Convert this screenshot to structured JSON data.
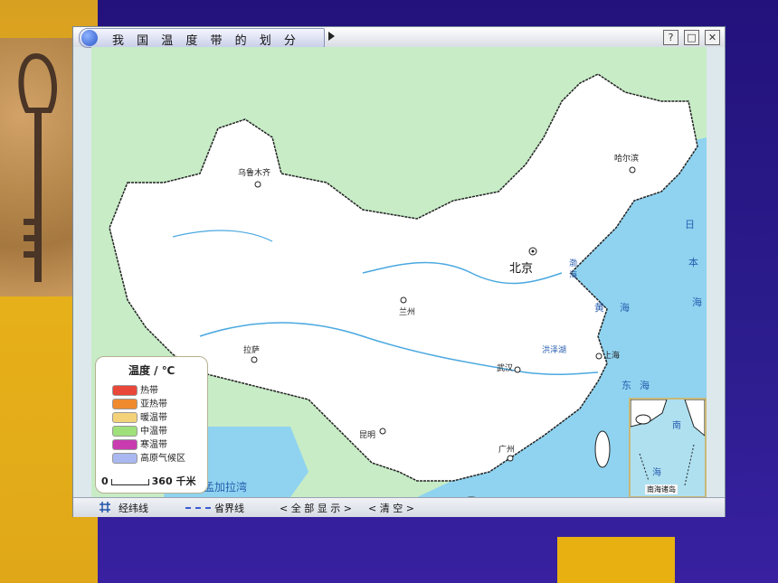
{
  "window": {
    "title": "我 国 温 度 带 的 划 分",
    "help_label": "?",
    "restore_label": "□",
    "close_label": "✕"
  },
  "map": {
    "cities": [
      {
        "name": "乌鲁木齐"
      },
      {
        "name": "哈尔滨"
      },
      {
        "name": "兰州"
      },
      {
        "name": "拉萨"
      },
      {
        "name": "武汉"
      },
      {
        "name": "上海"
      },
      {
        "name": "昆明"
      },
      {
        "name": "广州"
      }
    ],
    "capital": "北京",
    "seas": {
      "bohai": "渤海",
      "huanghai_1": "黄",
      "huanghai_2": "海",
      "donghai_1": "东",
      "donghai_2": "海",
      "nanhai_1": "南",
      "nanhai_2": "海",
      "riben_1": "日",
      "riben_2": "本",
      "riben_3": "海",
      "bengal": "孟加拉湾",
      "lake": "洪泽湖"
    }
  },
  "legend": {
    "title": "温度 / ℃",
    "items": [
      {
        "label": "热带",
        "color": "#e8473a"
      },
      {
        "label": "亚热带",
        "color": "#f08a2e"
      },
      {
        "label": "暖温带",
        "color": "#f3d27a"
      },
      {
        "label": "中温带",
        "color": "#9fe07a"
      },
      {
        "label": "寒温带",
        "color": "#c83cb0"
      },
      {
        "label": "高原气候区",
        "color": "#a9b8f0"
      }
    ],
    "scale_zero": "0",
    "scale_value": "360 千米"
  },
  "inset": {
    "label": "南海诸岛",
    "sea_1": "南",
    "sea_2": "海"
  },
  "statusbar": {
    "grid_label": "经纬线",
    "province_label": "省界线",
    "show_all": "< 全 部 显 示 >",
    "clear": "< 清   空 >"
  }
}
